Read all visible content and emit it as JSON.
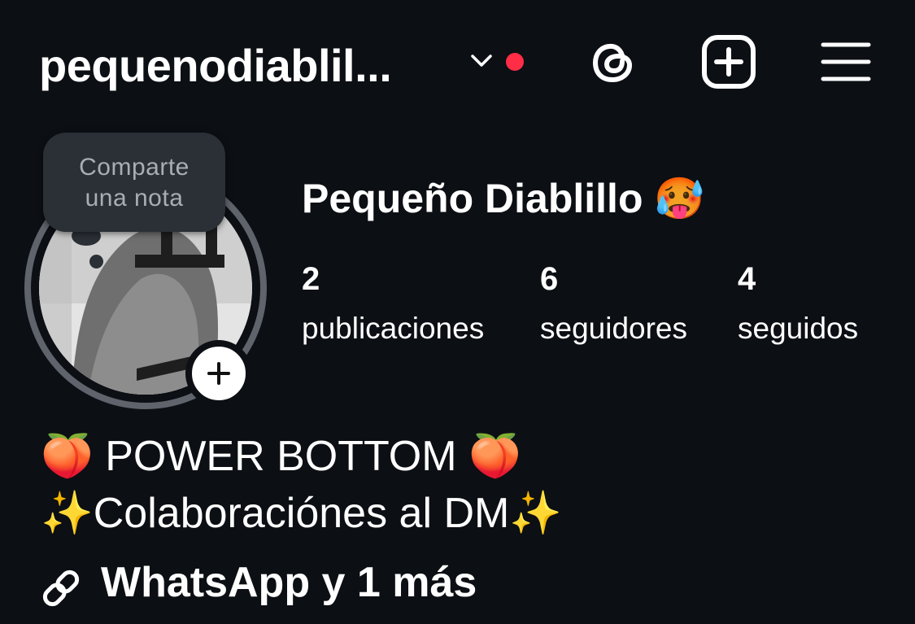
{
  "header": {
    "username": "pequenodiablil...",
    "icons": [
      "chevron-down-icon",
      "notification-dot",
      "threads-icon",
      "create-icon",
      "menu-icon"
    ],
    "colors": {
      "background": "#0c0f14",
      "notification_dot": "#ff2d46"
    }
  },
  "note": {
    "line1": "Comparte",
    "line2": "una nota"
  },
  "profile": {
    "display_name": "Pequeño Diablillo 🥵",
    "stats": {
      "posts_count": "2",
      "posts_label": "publicaciones",
      "followers_count": "6",
      "followers_label": "seguidores",
      "following_count": "4",
      "following_label": "seguidos"
    },
    "bio": {
      "line1": "🍑 POWER BOTTOM 🍑",
      "line2": "✨Colaboraciónes al DM✨"
    },
    "link_text": "WhatsApp y 1 más"
  }
}
